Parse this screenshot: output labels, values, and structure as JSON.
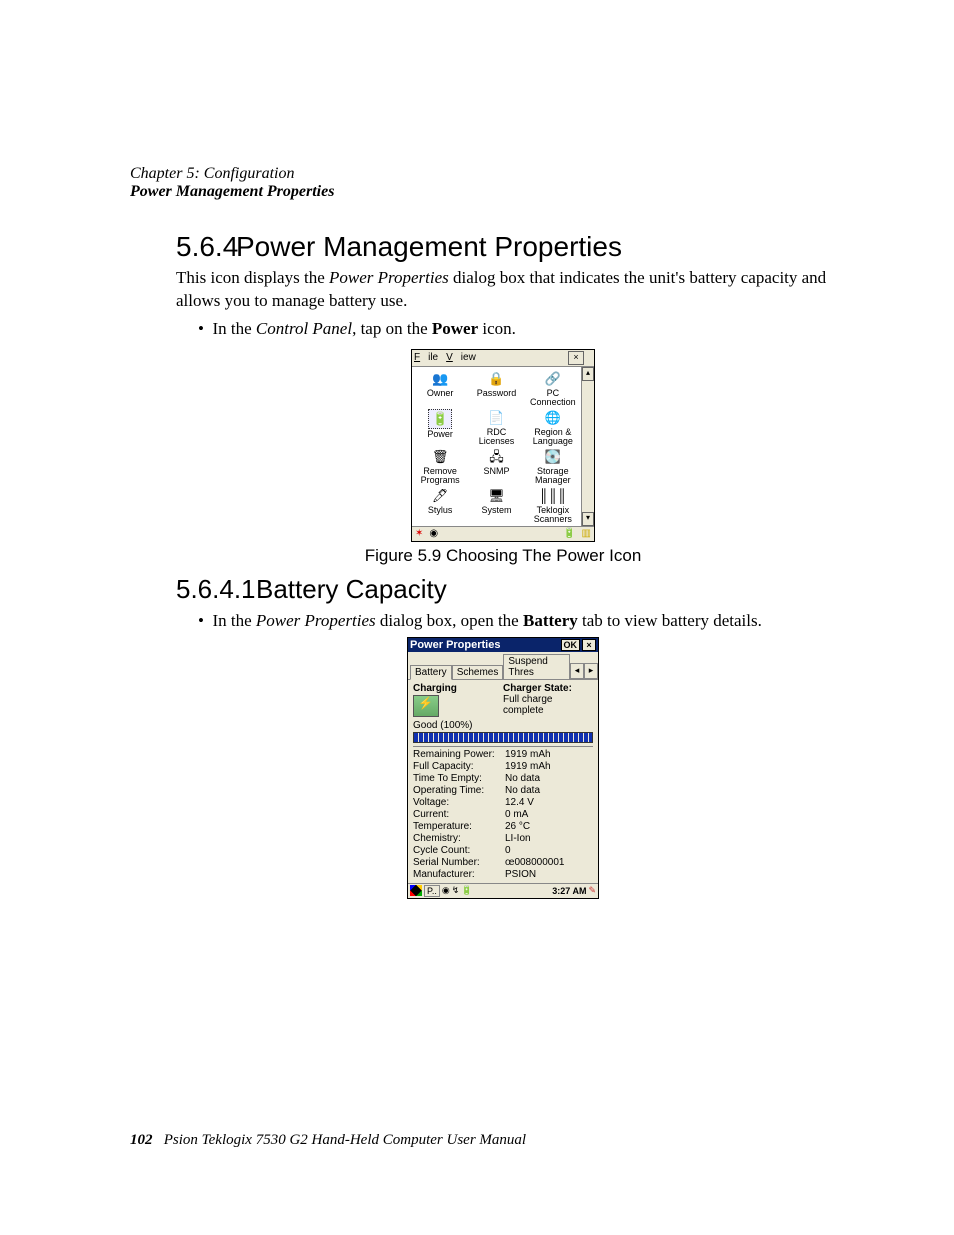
{
  "header": {
    "chapter": "Chapter 5: Configuration",
    "section": "Power Management Properties"
  },
  "h564": {
    "num": "5.6.4",
    "title": "Power Management Properties"
  },
  "intro": {
    "pre": "This icon displays the ",
    "dlg": "Power Properties",
    "post": " dialog box that indicates the unit's battery capacity and allows you to manage battery use."
  },
  "bullet1": {
    "pre": "In the ",
    "cp": "Control Panel",
    "mid": ", tap on the ",
    "pw": "Power",
    "post": " icon."
  },
  "cp": {
    "menu": {
      "file": "File",
      "view": "View"
    },
    "items": [
      {
        "label": "Owner",
        "icon": "👥"
      },
      {
        "label": "Password",
        "icon": "🔒"
      },
      {
        "label": "PC\nConnection",
        "icon": "🔗"
      },
      {
        "label": "Power",
        "icon": "🔋",
        "selected": true
      },
      {
        "label": "RDC\nLicenses",
        "icon": "📄"
      },
      {
        "label": "Region &\nLanguage",
        "icon": "🌐"
      },
      {
        "label": "Remove\nPrograms",
        "icon": "🗑"
      },
      {
        "label": "SNMP",
        "icon": "🖧"
      },
      {
        "label": "Storage\nManager",
        "icon": "💽"
      },
      {
        "label": "Stylus",
        "icon": "🖊"
      },
      {
        "label": "System",
        "icon": "🖥"
      },
      {
        "label": "Teklogix\nScanners",
        "icon": "║║║"
      }
    ]
  },
  "fig59": "Figure 5.9 Choosing The Power Icon",
  "h5641": {
    "num": "5.6.4.1",
    "title": "Battery Capacity"
  },
  "bullet2": {
    "pre": "In the ",
    "pp": "Power Properties",
    "mid": " dialog box, open the ",
    "bat": "Battery",
    "post": " tab to view battery details."
  },
  "pp": {
    "title": "Power Properties",
    "ok": "OK",
    "tabs": {
      "battery": "Battery",
      "schemes": "Schemes",
      "suspend": "Suspend Thres"
    },
    "charging": "Charging",
    "charger_state_hdr": "Charger State:",
    "charger_state": "Full charge complete",
    "good": "Good  (100%)",
    "stats": [
      {
        "k": "Remaining Power:",
        "v": "1919 mAh"
      },
      {
        "k": "Full Capacity:",
        "v": "1919 mAh"
      },
      {
        "k": "Time To Empty:",
        "v": "No data"
      },
      {
        "k": "Operating Time:",
        "v": "No data"
      },
      {
        "k": "Voltage:",
        "v": "12.4 V"
      },
      {
        "k": "Current:",
        "v": "0 mA"
      },
      {
        "k": "Temperature:",
        "v": "26 °C"
      },
      {
        "k": "Chemistry:",
        "v": "LI-Ion"
      },
      {
        "k": "Cycle Count:",
        "v": "0"
      },
      {
        "k": "Serial Number:",
        "v": "œ008000001"
      },
      {
        "k": "Manufacturer:",
        "v": "PSION"
      }
    ],
    "task": {
      "app": "P..",
      "time": "3:27 AM"
    }
  },
  "footer": {
    "page": "102",
    "book": "Psion Teklogix 7530 G2 Hand-Held Computer User Manual"
  }
}
